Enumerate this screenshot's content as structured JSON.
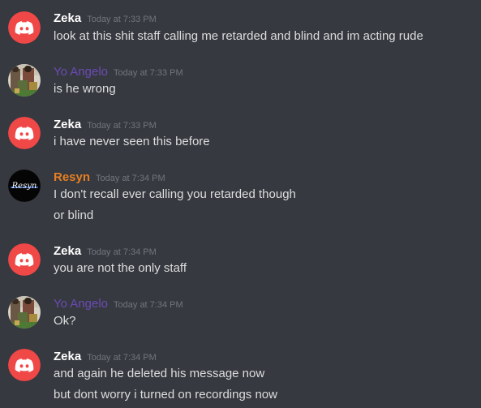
{
  "messages": [
    {
      "author": "Zeka",
      "author_color": "#ffffff",
      "avatar": "discord-logo-icon",
      "timestamp": "Today at 7:33 PM",
      "lines": [
        "look at this shit staff calling me retarded and blind and im acting rude"
      ]
    },
    {
      "author": "Yo Angelo",
      "author_color": "#6c4bb7",
      "avatar": "user-photo-avatar",
      "timestamp": "Today at 7:33 PM",
      "lines": [
        "is he wrong"
      ]
    },
    {
      "author": "Zeka",
      "author_color": "#ffffff",
      "avatar": "discord-logo-icon",
      "timestamp": "Today at 7:33 PM",
      "lines": [
        "i have never seen this before"
      ]
    },
    {
      "author": "Resyn",
      "author_color": "#e67e22",
      "avatar": "resyn-logo-avatar",
      "avatar_text": "Resyn",
      "timestamp": "Today at 7:34 PM",
      "lines": [
        "I don't recall ever calling you retarded though",
        "or blind"
      ]
    },
    {
      "author": "Zeka",
      "author_color": "#ffffff",
      "avatar": "discord-logo-icon",
      "timestamp": "Today at 7:34 PM",
      "lines": [
        "you are not the only staff"
      ]
    },
    {
      "author": "Yo Angelo",
      "author_color": "#6c4bb7",
      "avatar": "user-photo-avatar",
      "timestamp": "Today at 7:34 PM",
      "lines": [
        "Ok?"
      ]
    },
    {
      "author": "Zeka",
      "author_color": "#ffffff",
      "avatar": "discord-logo-icon",
      "timestamp": "Today at 7:34 PM",
      "lines": [
        "and again he deleted his message now",
        "but dont worry i turned on recordings now"
      ]
    }
  ],
  "colors": {
    "background": "#36393f",
    "discord_red": "#f04747",
    "text": "#dcddde",
    "timestamp": "#72767d"
  }
}
